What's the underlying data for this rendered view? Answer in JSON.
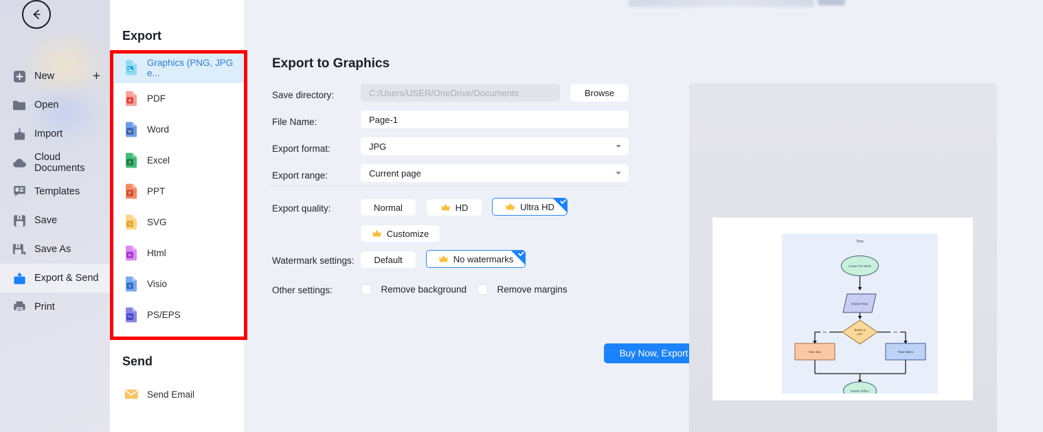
{
  "left_nav": {
    "back_label": "Back",
    "items": [
      {
        "label": "New",
        "icon": "plus-square-icon",
        "active": false,
        "has_plus": true
      },
      {
        "label": "Open",
        "icon": "folder-icon",
        "active": false
      },
      {
        "label": "Import",
        "icon": "import-icon",
        "active": false
      },
      {
        "label": "Cloud Documents",
        "icon": "cloud-icon",
        "active": false
      },
      {
        "label": "Templates",
        "icon": "templates-icon",
        "active": false
      },
      {
        "label": "Save",
        "icon": "save-icon",
        "active": false
      },
      {
        "label": "Save As",
        "icon": "save-as-icon",
        "active": false
      },
      {
        "label": "Export & Send",
        "icon": "export-send-icon",
        "active": true
      },
      {
        "label": "Print",
        "icon": "printer-icon",
        "active": false
      }
    ]
  },
  "export_panel": {
    "title": "Export",
    "formats": [
      {
        "label": "Graphics (PNG, JPG e...",
        "icon": "graphics-file-icon",
        "color": "#5ac8e8",
        "letter": "",
        "selected": true
      },
      {
        "label": "PDF",
        "icon": "pdf-file-icon",
        "color": "#ee7a72",
        "letter": "A",
        "selected": false
      },
      {
        "label": "Word",
        "icon": "word-file-icon",
        "color": "#3e6fd0",
        "letter": "W",
        "selected": false
      },
      {
        "label": "Excel",
        "icon": "excel-file-icon",
        "color": "#1f9a52",
        "letter": "X",
        "selected": false
      },
      {
        "label": "PPT",
        "icon": "ppt-file-icon",
        "color": "#e4502a",
        "letter": "P",
        "selected": false
      },
      {
        "label": "SVG",
        "icon": "svg-file-icon",
        "color": "#f0b63d",
        "letter": "S",
        "selected": false
      },
      {
        "label": "Html",
        "icon": "html-file-icon",
        "color": "#c452e8",
        "letter": "H",
        "selected": false
      },
      {
        "label": "Visio",
        "icon": "visio-file-icon",
        "color": "#4b90e8",
        "letter": "V",
        "selected": false
      },
      {
        "label": "PS/EPS",
        "icon": "ps-eps-file-icon",
        "color": "#5b59d6",
        "letter": "Ps",
        "selected": false
      }
    ],
    "send_title": "Send",
    "send_item": {
      "label": "Send Email",
      "icon": "envelope-icon",
      "color": "#f5b942"
    }
  },
  "main": {
    "heading": "Export to Graphics",
    "fields": {
      "save_directory_label": "Save directory:",
      "save_directory_value": "C:/Users/USER/OneDrive/Documents",
      "browse_label": "Browse",
      "file_name_label": "File Name:",
      "file_name_value": "Page-1",
      "export_format_label": "Export format:",
      "export_format_value": "JPG",
      "export_range_label": "Export range:",
      "export_range_value": "Current page"
    },
    "quality": {
      "label": "Export quality:",
      "options": [
        {
          "label": "Normal",
          "crown": false,
          "selected": false
        },
        {
          "label": "HD",
          "crown": true,
          "selected": false
        },
        {
          "label": "Ultra HD",
          "crown": true,
          "selected": true
        },
        {
          "label": "Customize",
          "crown": true,
          "selected": false
        }
      ]
    },
    "watermark": {
      "label": "Watermark settings:",
      "options": [
        {
          "label": "Default",
          "crown": false,
          "selected": false
        },
        {
          "label": "No watermarks",
          "crown": true,
          "selected": true
        }
      ]
    },
    "other": {
      "label": "Other settings:",
      "checkboxes": [
        {
          "label": "Remove background",
          "checked": false
        },
        {
          "label": "Remove margins",
          "checked": false
        }
      ]
    },
    "primary_button": "Buy Now, Export",
    "accent_color": "#1a82fb",
    "highlight_color": "#fe0000"
  },
  "preview": {
    "diagram_title": "Time",
    "nodes": [
      {
        "id": "start",
        "text": "Leave For Work",
        "shape": "ellipse",
        "fill": "#c9efdd"
      },
      {
        "id": "check",
        "text": "Check Time",
        "shape": "parallelogram",
        "fill": "#c8cdf2"
      },
      {
        "id": "decide",
        "text": "Before 8 am?",
        "shape": "diamond",
        "fill": "#fbd79a"
      },
      {
        "id": "bus",
        "text": "Take Bus",
        "shape": "rect",
        "fill": "#f9c9a6"
      },
      {
        "id": "metro",
        "text": "Take Metro",
        "shape": "rect",
        "fill": "#bed2f5"
      },
      {
        "id": "end",
        "text": "Reach Office",
        "shape": "ellipse",
        "fill": "#c9efdd"
      }
    ],
    "edge_labels": {
      "left": "No",
      "right": "Yes"
    }
  }
}
